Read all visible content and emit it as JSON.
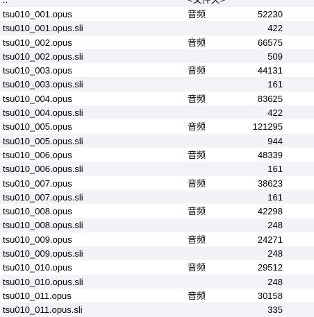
{
  "parent_row": {
    "name": "..",
    "type": "<文件夹>"
  },
  "files": [
    {
      "name": "tsu010_001.opus",
      "type": "音频",
      "size": "52230"
    },
    {
      "name": "tsu010_001.opus.sli",
      "type": "",
      "size": "422"
    },
    {
      "name": "tsu010_002.opus",
      "type": "音频",
      "size": "66575"
    },
    {
      "name": "tsu010_002.opus.sli",
      "type": "",
      "size": "509"
    },
    {
      "name": "tsu010_003.opus",
      "type": "音频",
      "size": "44131"
    },
    {
      "name": "tsu010_003.opus.sli",
      "type": "",
      "size": "161"
    },
    {
      "name": "tsu010_004.opus",
      "type": "音频",
      "size": "83625"
    },
    {
      "name": "tsu010_004.opus.sli",
      "type": "",
      "size": "422"
    },
    {
      "name": "tsu010_005.opus",
      "type": "音频",
      "size": "121295"
    },
    {
      "name": "tsu010_005.opus.sli",
      "type": "",
      "size": "944"
    },
    {
      "name": "tsu010_006.opus",
      "type": "音频",
      "size": "48339"
    },
    {
      "name": "tsu010_006.opus.sli",
      "type": "",
      "size": "161"
    },
    {
      "name": "tsu010_007.opus",
      "type": "音频",
      "size": "38623"
    },
    {
      "name": "tsu010_007.opus.sli",
      "type": "",
      "size": "161"
    },
    {
      "name": "tsu010_008.opus",
      "type": "音频",
      "size": "42298"
    },
    {
      "name": "tsu010_008.opus.sli",
      "type": "",
      "size": "248"
    },
    {
      "name": "tsu010_009.opus",
      "type": "音频",
      "size": "24271"
    },
    {
      "name": "tsu010_009.opus.sli",
      "type": "",
      "size": "248"
    },
    {
      "name": "tsu010_010.opus",
      "type": "音频",
      "size": "29512"
    },
    {
      "name": "tsu010_010.opus.sli",
      "type": "",
      "size": "248"
    },
    {
      "name": "tsu010_011.opus",
      "type": "音频",
      "size": "30158"
    },
    {
      "name": "tsu010_011.opus.sli",
      "type": "",
      "size": "335"
    }
  ]
}
